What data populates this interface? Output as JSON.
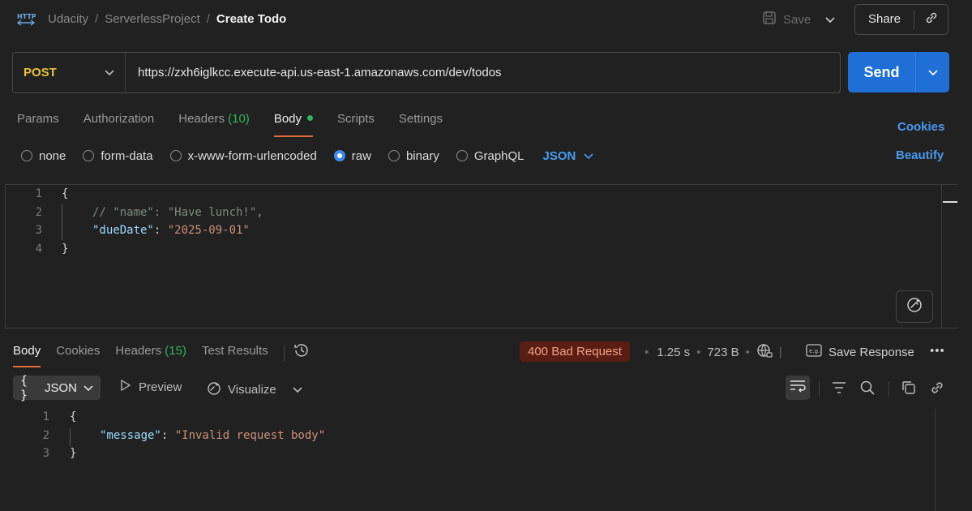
{
  "breadcrumb": {
    "workspace": "Udacity",
    "collection": "ServerlessProject",
    "request": "Create Todo"
  },
  "header": {
    "save_label": "Save",
    "share_label": "Share"
  },
  "request": {
    "method": "POST",
    "url": "https://zxh6iglkcc.execute-api.us-east-1.amazonaws.com/dev/todos",
    "send_label": "Send"
  },
  "request_tabs": [
    {
      "label": "Params"
    },
    {
      "label": "Authorization"
    },
    {
      "label": "Headers",
      "count": "(10)"
    },
    {
      "label": "Body"
    },
    {
      "label": "Scripts"
    },
    {
      "label": "Settings"
    }
  ],
  "cookies_label": "Cookies",
  "beautify_label": "Beautify",
  "body_types": [
    "none",
    "form-data",
    "x-www-form-urlencoded",
    "raw",
    "binary",
    "GraphQL"
  ],
  "body_type_selected": "raw",
  "body_language": "JSON",
  "editor": {
    "line_numbers": [
      "1",
      "2",
      "3",
      "4"
    ],
    "open_brace": "{",
    "line2": "// \"name\": \"Have lunch!\",",
    "key3": "\"dueDate\"",
    "colon3": ": ",
    "val3": "\"2025-09-01\"",
    "close_brace": "}"
  },
  "response_tabs": [
    {
      "label": "Body"
    },
    {
      "label": "Cookies"
    },
    {
      "label": "Headers",
      "count": "(15)"
    },
    {
      "label": "Test Results"
    }
  ],
  "response": {
    "status": "400 Bad Request",
    "time": "1.25 s",
    "size": "723 B",
    "save_response_label": "Save Response",
    "format": "JSON",
    "preview_label": "Preview",
    "visualize_label": "Visualize",
    "line_numbers": [
      "1",
      "2",
      "3"
    ],
    "open_brace": "{",
    "key2": "\"message\"",
    "colon2": ": ",
    "val2": "\"Invalid request body\"",
    "close_brace": "}"
  },
  "colors": {
    "accent": "#1f6fd6",
    "method_post": "#e8c23a",
    "status_error_bg": "#5a1d14",
    "active_tab_underline": "#e26b3b",
    "count_green": "#2fb461"
  }
}
